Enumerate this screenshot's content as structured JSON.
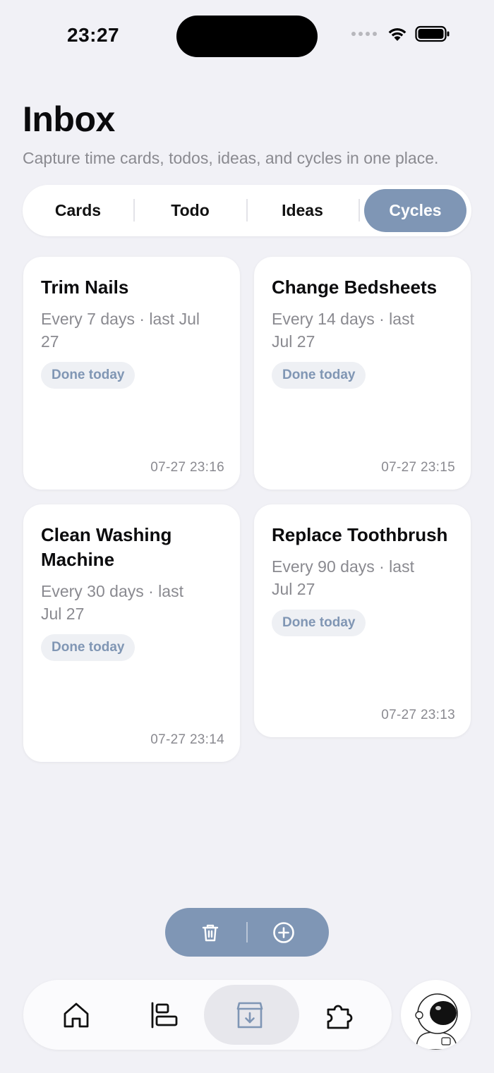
{
  "status_bar": {
    "time": "23:27"
  },
  "header": {
    "title": "Inbox",
    "subtitle": "Capture time cards, todos, ideas, and cycles in one place."
  },
  "tabs": [
    {
      "label": "Cards",
      "active": false
    },
    {
      "label": "Todo",
      "active": false
    },
    {
      "label": "Ideas",
      "active": false
    },
    {
      "label": "Cycles",
      "active": true
    }
  ],
  "cycles": [
    {
      "title": "Trim Nails",
      "meta": "Every 7 days · last Jul 27",
      "badge": "Done today",
      "timestamp": "07-27 23:16"
    },
    {
      "title": "Change Bedsheets",
      "meta": "Every 14 days · last Jul 27",
      "badge": "Done today",
      "timestamp": "07-27 23:15"
    },
    {
      "title": "Clean Washing Machine",
      "meta": "Every 30 days · last Jul 27",
      "badge": "Done today",
      "timestamp": "07-27 23:14"
    },
    {
      "title": "Replace Toothbrush",
      "meta": "Every 90 days · last Jul 27",
      "badge": "Done today",
      "timestamp": "07-27 23:13"
    }
  ],
  "action_bar": {
    "icons": [
      "trash-icon",
      "plus-circle-icon"
    ]
  },
  "tab_bar": {
    "items": [
      {
        "icon": "home-icon",
        "active": false
      },
      {
        "icon": "align-left-icon",
        "active": false
      },
      {
        "icon": "inbox-download-icon",
        "active": true
      },
      {
        "icon": "puzzle-icon",
        "active": false
      }
    ],
    "avatar_icon": "astronaut-avatar"
  },
  "colors": {
    "accent": "#7f96b5",
    "background": "#f1f1f6",
    "card": "#ffffff",
    "muted_text": "#8a8a90"
  }
}
